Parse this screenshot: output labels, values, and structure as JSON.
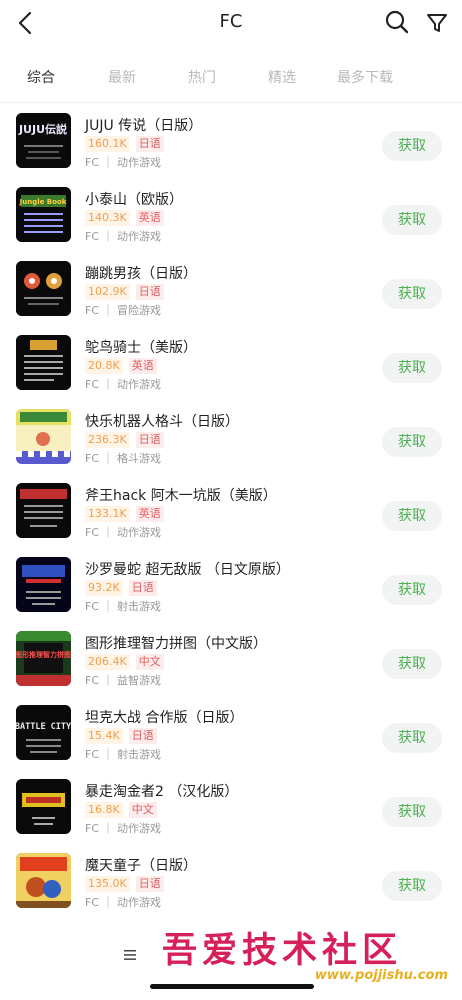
{
  "header": {
    "title": "FC",
    "back_icon": "chevron-left-icon",
    "search_icon": "search-icon",
    "filter_icon": "filter-icon"
  },
  "tabs": [
    {
      "label": "综合",
      "active": true
    },
    {
      "label": "最新",
      "active": false
    },
    {
      "label": "热门",
      "active": false
    },
    {
      "label": "精选",
      "active": false
    },
    {
      "label": "最多下载",
      "active": false
    }
  ],
  "games": [
    {
      "name": "JUJU 传说（日版）",
      "size": "160.1K",
      "lang": "日语",
      "platform": "FC",
      "genre": "动作游戏",
      "button": "获取"
    },
    {
      "name": "小泰山（欧版）",
      "size": "140.3K",
      "lang": "英语",
      "platform": "FC",
      "genre": "动作游戏",
      "button": "获取"
    },
    {
      "name": "蹦跳男孩（日版）",
      "size": "102.9K",
      "lang": "日语",
      "platform": "FC",
      "genre": "冒险游戏",
      "button": "获取"
    },
    {
      "name": "鸵鸟骑士（美版）",
      "size": "20.8K",
      "lang": "英语",
      "platform": "FC",
      "genre": "动作游戏",
      "button": "获取"
    },
    {
      "name": "快乐机器人格斗（日版）",
      "size": "236.3K",
      "lang": "日语",
      "platform": "FC",
      "genre": "格斗游戏",
      "button": "获取"
    },
    {
      "name": "斧王hack 阿木一坑版（美版）",
      "size": "133.1K",
      "lang": "英语",
      "platform": "FC",
      "genre": "动作游戏",
      "button": "获取"
    },
    {
      "name": "沙罗曼蛇 超无敌版 （日文原版）",
      "size": "93.2K",
      "lang": "日语",
      "platform": "FC",
      "genre": "射击游戏",
      "button": "获取"
    },
    {
      "name": "图形推理智力拼图（中文版）",
      "size": "206.4K",
      "lang": "中文",
      "platform": "FC",
      "genre": "益智游戏",
      "button": "获取"
    },
    {
      "name": "坦克大战 合作版（日版）",
      "size": "15.4K",
      "lang": "日语",
      "platform": "FC",
      "genre": "射击游戏",
      "button": "获取"
    },
    {
      "name": "暴走淘金者2 （汉化版）",
      "size": "16.8K",
      "lang": "中文",
      "platform": "FC",
      "genre": "动作游戏",
      "button": "获取"
    },
    {
      "name": "魔天童子（日版）",
      "size": "135.0K",
      "lang": "日语",
      "platform": "FC",
      "genre": "动作游戏",
      "button": "获取"
    }
  ],
  "thumb_texts": {
    "juju": "JUJU伝説",
    "jungle": "Jungle Book",
    "battle": "BATTLE CITY",
    "puzzle": "图形推理智力拼图"
  },
  "watermark": {
    "main": "吾爱技术社区",
    "url": "www.pojjishu.com"
  },
  "colors": {
    "accent_green": "#4caf50",
    "size_orange": "#f0a050",
    "lang_red": "#e06060",
    "watermark_red": "#d6205a",
    "watermark_gold": "#e8b020"
  }
}
